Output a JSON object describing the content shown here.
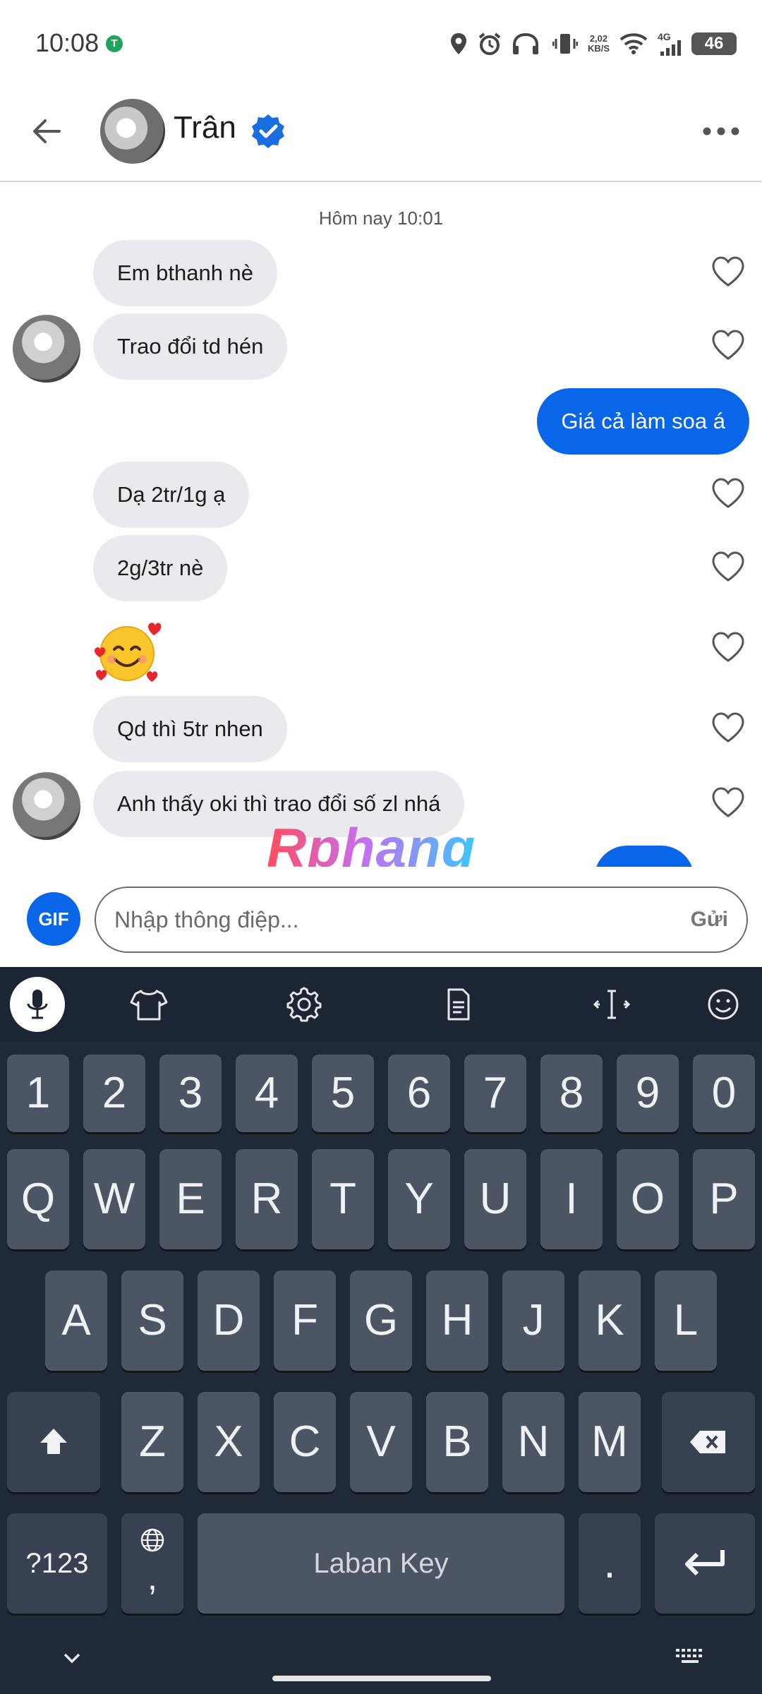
{
  "status": {
    "time": "10:08",
    "app_dot": "T",
    "speed_top": "2,02",
    "speed_bottom": "KB/S",
    "network": "4G",
    "battery": "46"
  },
  "header": {
    "contact_name": "Trân",
    "verified": true
  },
  "chat": {
    "timestamp": "Hôm nay 10:01",
    "messages": [
      {
        "dir": "in",
        "text": "Em bthanh nè"
      },
      {
        "dir": "in",
        "text": "Trao đổi td hén"
      },
      {
        "dir": "out",
        "text": "Giá cả làm soa á"
      },
      {
        "dir": "in",
        "text": "Dạ 2tr/1g ạ"
      },
      {
        "dir": "in",
        "text": "2g/3tr nè"
      },
      {
        "dir": "in",
        "emoji": "smiling-face-with-hearts"
      },
      {
        "dir": "in",
        "text": "Qd thì 5tr nhen"
      },
      {
        "dir": "in",
        "text": "Anh thấy oki thì trao đổi số zl nhá"
      }
    ],
    "watermark": "Rphang"
  },
  "composer": {
    "gif_label": "GIF",
    "placeholder": "Nhập thông điệp...",
    "send_label": "Gửi"
  },
  "keyboard": {
    "number_row": [
      "1",
      "2",
      "3",
      "4",
      "5",
      "6",
      "7",
      "8",
      "9",
      "0"
    ],
    "row1": [
      "Q",
      "W",
      "E",
      "R",
      "T",
      "Y",
      "U",
      "I",
      "O",
      "P"
    ],
    "row2": [
      "A",
      "S",
      "D",
      "F",
      "G",
      "H",
      "J",
      "K",
      "L"
    ],
    "row3": [
      "Z",
      "X",
      "C",
      "V",
      "B",
      "N",
      "M"
    ],
    "symbols_label": "?123",
    "comma_label": ",",
    "space_label": "Laban Key",
    "period_label": ".",
    "toolbar_icons": [
      "mic-icon",
      "shirt-icon",
      "gear-icon",
      "clipboard-icon",
      "cursor-icon",
      "emoji-icon"
    ]
  },
  "colors": {
    "accent": "#0a66e8",
    "incoming_bubble": "#e9e9ee",
    "keyboard_bg": "#1f2937",
    "key_bg": "#4b5563"
  }
}
